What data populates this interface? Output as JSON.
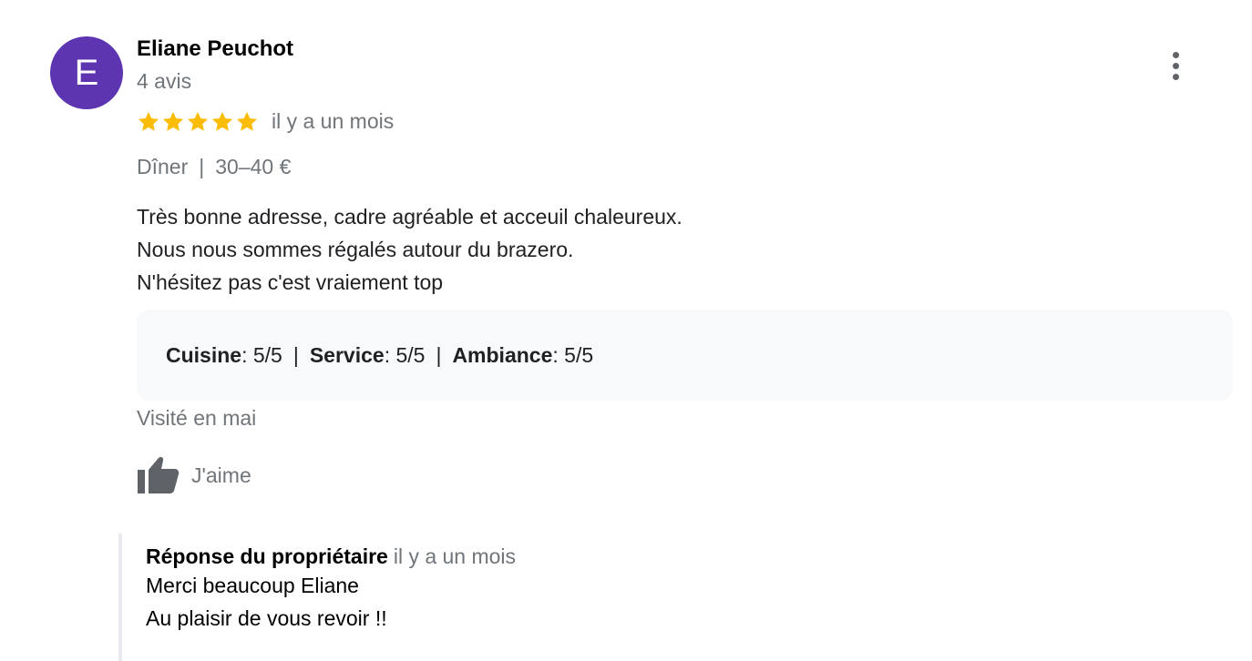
{
  "author": {
    "initial": "E",
    "name": "Eliane Peuchot",
    "review_count": "4 avis"
  },
  "review": {
    "rating_stars": 5,
    "rating_max": 5,
    "date": "il y a un mois",
    "meal": "Dîner",
    "separator": "|",
    "price": "30–40 €",
    "text_lines": [
      "Très bonne adresse, cadre agréable et acceuil chaleureux.",
      "Nous nous sommes régalés autour du brazero.",
      "N'hésitez pas c'est vraiement top"
    ],
    "sub_ratings": [
      {
        "label": "Cuisine",
        "value": " : 5/5"
      },
      {
        "label": "Service",
        "value": " : 5/5"
      },
      {
        "label": "Ambiance",
        "value": " : 5/5"
      }
    ],
    "visited": "Visité en mai"
  },
  "actions": {
    "like_label": "J'aime",
    "like_icon": "thumb-up-icon",
    "more_icon": "more-vert-icon"
  },
  "owner_reply": {
    "title": "Réponse du propriétaire",
    "date": "il y a un mois",
    "lines": [
      "Merci beaucoup Eliane",
      "Au plaisir de vous revoir !!"
    ]
  },
  "colors": {
    "avatar_bg": "#5e35b1",
    "star": "#fbbc04",
    "muted_text": "#70757a",
    "ratings_box_bg": "#f8f9fa"
  }
}
